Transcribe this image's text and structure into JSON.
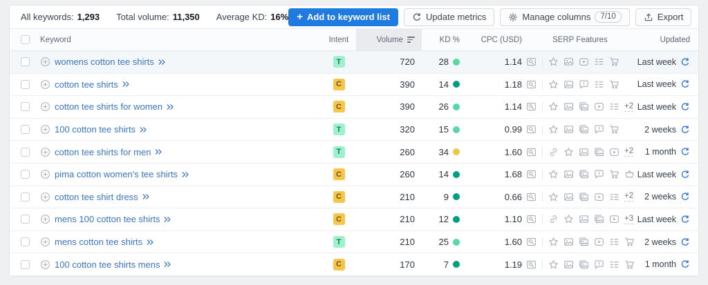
{
  "toolbar": {
    "stats": [
      {
        "label": "All keywords:",
        "value": "1,293"
      },
      {
        "label": "Total volume:",
        "value": "11,350"
      },
      {
        "label": "Average KD:",
        "value": "16%"
      }
    ],
    "buttons": {
      "add_to_list": "Add to keyword list",
      "update_metrics": "Update metrics",
      "manage_columns": "Manage columns",
      "manage_columns_count": "7/10",
      "export": "Export"
    }
  },
  "table": {
    "headers": {
      "keyword": "Keyword",
      "intent": "Intent",
      "volume": "Volume",
      "kd": "KD %",
      "cpc": "CPC (USD)",
      "serp": "SERP Features",
      "updated": "Updated"
    },
    "rows": [
      {
        "keyword": "womens cotton tee shirts",
        "intent": "T",
        "volume": "720",
        "kd": "28",
        "kd_level": "easy",
        "cpc": "1.14",
        "serp_features": [
          "star",
          "image",
          "video",
          "sitelinks",
          "cart"
        ],
        "serp_extra": "",
        "updated": "Last week",
        "highlighted": true
      },
      {
        "keyword": "cotton tee shirts",
        "intent": "C",
        "volume": "390",
        "kd": "14",
        "kd_level": "very_easy",
        "cpc": "1.18",
        "serp_features": [
          "star",
          "image",
          "comment",
          "sitelinks",
          "cart"
        ],
        "serp_extra": "",
        "updated": "Last week",
        "highlighted": false
      },
      {
        "keyword": "cotton tee shirts for women",
        "intent": "C",
        "volume": "390",
        "kd": "26",
        "kd_level": "easy",
        "cpc": "1.14",
        "serp_features": [
          "star",
          "image",
          "images",
          "video",
          "sitelinks"
        ],
        "serp_extra": "+2",
        "updated": "Last week",
        "highlighted": false
      },
      {
        "keyword": "100 cotton tee shirts",
        "intent": "T",
        "volume": "320",
        "kd": "15",
        "kd_level": "easy",
        "cpc": "0.99",
        "serp_features": [
          "star",
          "image",
          "images",
          "comment",
          "cart"
        ],
        "serp_extra": "",
        "updated": "2 weeks",
        "highlighted": false
      },
      {
        "keyword": "cotton tee shirts for men",
        "intent": "T",
        "volume": "260",
        "kd": "34",
        "kd_level": "possible",
        "cpc": "1.60",
        "serp_features": [
          "link",
          "star",
          "image",
          "images",
          "video"
        ],
        "serp_extra": "+2",
        "updated": "1 month",
        "highlighted": false
      },
      {
        "keyword": "pima cotton women's tee shirts",
        "intent": "C",
        "volume": "260",
        "kd": "14",
        "kd_level": "very_easy",
        "cpc": "1.68",
        "serp_features": [
          "star",
          "image",
          "images",
          "comment",
          "cart",
          "trolley"
        ],
        "serp_extra": "",
        "updated": "Last week",
        "highlighted": false
      },
      {
        "keyword": "cotton tee shirt dress",
        "intent": "C",
        "volume": "210",
        "kd": "9",
        "kd_level": "very_easy",
        "cpc": "0.66",
        "serp_features": [
          "star",
          "image",
          "images",
          "video",
          "sitelinks"
        ],
        "serp_extra": "+2",
        "updated": "2 weeks",
        "highlighted": false
      },
      {
        "keyword": "mens 100 cotton tee shirts",
        "intent": "C",
        "volume": "210",
        "kd": "12",
        "kd_level": "very_easy",
        "cpc": "1.10",
        "serp_features": [
          "link",
          "star",
          "image",
          "images",
          "video"
        ],
        "serp_extra": "+3",
        "updated": "Last week",
        "highlighted": false
      },
      {
        "keyword": "mens cotton tee shirts",
        "intent": "T",
        "volume": "210",
        "kd": "25",
        "kd_level": "easy",
        "cpc": "1.60",
        "serp_features": [
          "star",
          "image",
          "images",
          "video",
          "sitelinks",
          "cart"
        ],
        "serp_extra": "",
        "updated": "2 weeks",
        "highlighted": false
      },
      {
        "keyword": "100 cotton tee shirts mens",
        "intent": "C",
        "volume": "170",
        "kd": "7",
        "kd_level": "very_easy",
        "cpc": "1.19",
        "serp_features": [
          "star",
          "image",
          "images",
          "comment",
          "sitelinks",
          "cart"
        ],
        "serp_extra": "",
        "updated": "1 month",
        "highlighted": false
      }
    ]
  },
  "colors": {
    "accent_blue": "#1f7be0",
    "link_blue": "#3a76c4",
    "refresh_blue": "#2e74d9",
    "kd_very_easy": "#009f81",
    "kd_easy": "#57d9a3",
    "kd_possible": "#f4c542",
    "intent": {
      "T": {
        "bg": "#9df2cd",
        "fg": "#16795f"
      },
      "C": {
        "bg": "#f6c54a",
        "fg": "#6a5418"
      }
    }
  }
}
